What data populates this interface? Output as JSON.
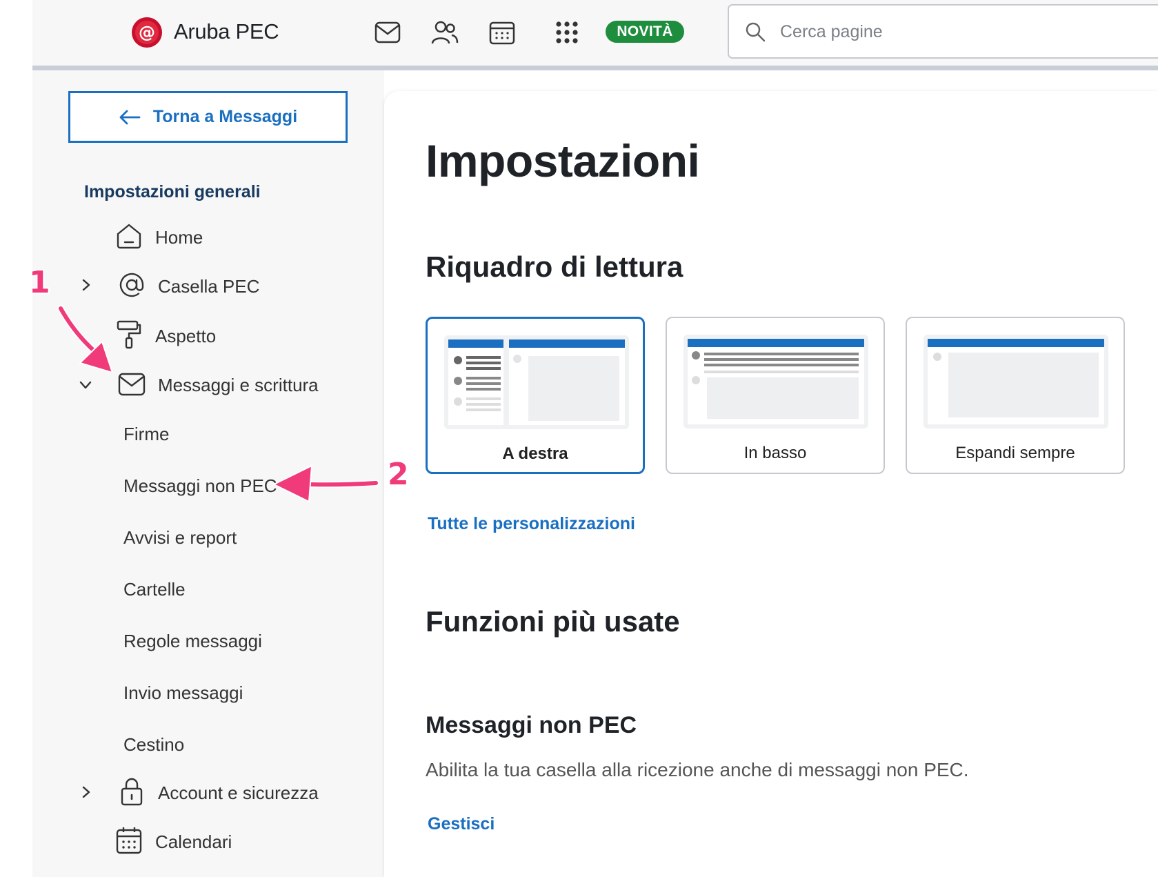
{
  "header": {
    "brand": "Aruba PEC",
    "badge": "NOVITÀ",
    "search_placeholder": "Cerca pagine",
    "icons": [
      "mail-icon",
      "contacts-icon",
      "calendar-icon",
      "apps-grid-icon"
    ]
  },
  "sidebar": {
    "back_label": "Torna a Messaggi",
    "section_title": "Impostazioni generali",
    "items": [
      {
        "label": "Home",
        "icon": "home-icon"
      },
      {
        "label": "Casella PEC",
        "icon": "at-icon",
        "expand": "collapsed"
      },
      {
        "label": "Aspetto",
        "icon": "paint-roller-icon"
      },
      {
        "label": "Messaggi e scrittura",
        "icon": "mail-icon",
        "expand": "expanded"
      },
      {
        "label": "Account e sicurezza",
        "icon": "lock-icon",
        "expand": "collapsed"
      },
      {
        "label": "Calendari",
        "icon": "calendar-icon"
      }
    ],
    "subitems": [
      "Firme",
      "Messaggi non PEC",
      "Avvisi e report",
      "Cartelle",
      "Regole messaggi",
      "Invio messaggi",
      "Cestino"
    ]
  },
  "annotations": {
    "first": "1",
    "second": "2",
    "color": "#f03a7a"
  },
  "main": {
    "title": "Impostazioni",
    "reading_pane": {
      "title": "Riquadro di lettura",
      "options": [
        "A destra",
        "In basso",
        "Espandi sempre"
      ],
      "selected": "A destra",
      "link": "Tutte le personalizzazioni"
    },
    "most_used": {
      "title": "Funzioni più usate",
      "item_title": "Messaggi non PEC",
      "item_desc": "Abilita la tua casella alla ricezione anche di messaggi non PEC.",
      "item_link": "Gestisci"
    }
  },
  "colors": {
    "accent": "#1a6fc1",
    "badge": "#1e8e3e",
    "annotation": "#f03a7a"
  }
}
